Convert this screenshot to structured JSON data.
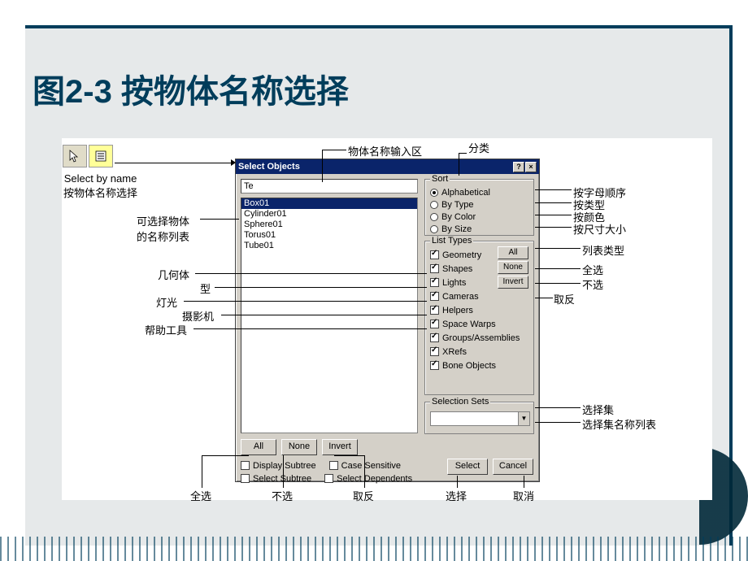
{
  "slide": {
    "title": "图2-3 按物体名称选择"
  },
  "dialog": {
    "title": "Select Objects",
    "search_value": "Te",
    "items": [
      "Box01",
      "Cylinder01",
      "Sphere01",
      "Torus01",
      "Tube01"
    ],
    "selected_index": 0,
    "sort": {
      "legend": "Sort",
      "options": [
        "Alphabetical",
        "By Type",
        "By Color",
        "By Size"
      ],
      "selected": 0
    },
    "list_types": {
      "legend": "List Types",
      "types": [
        "Geometry",
        "Shapes",
        "Lights",
        "Cameras",
        "Helpers",
        "Space Warps",
        "Groups/Assemblies",
        "XRefs",
        "Bone Objects"
      ],
      "buttons": {
        "all": "All",
        "none": "None",
        "invert": "Invert"
      }
    },
    "selection_sets": {
      "legend": "Selection Sets"
    },
    "bottom_buttons": {
      "all": "All",
      "none": "None",
      "invert": "Invert"
    },
    "bottom_checks": {
      "display_subtree": "Display Subtree",
      "select_subtree": "Select Subtree",
      "case_sensitive": "Case Sensitive",
      "select_dependents": "Select Dependents"
    },
    "main_buttons": {
      "select": "Select",
      "cancel": "Cancel"
    }
  },
  "callouts": {
    "select_by_name": "Select by name\n按物体名称选择",
    "name_input": "物体名称输入区",
    "sort_group": "分类",
    "alpha": "按字母顺序",
    "bytype": "按类型",
    "bycolor": "按颜色",
    "bysize": "按尺寸大小",
    "list_types": "列表类型",
    "all": "全选",
    "none": "不选",
    "invert": "取反",
    "list_names": "可选择物体\n的名称列表",
    "geometry": "几何体",
    "shapes": "型",
    "lights": "灯光",
    "cameras": "摄影机",
    "helpers": "帮助工具",
    "selsets": "选择集",
    "selsets_list": "选择集名称列表",
    "b_all": "全选",
    "b_none": "不选",
    "b_invert": "取反",
    "b_select": "选择",
    "b_cancel": "取消"
  }
}
